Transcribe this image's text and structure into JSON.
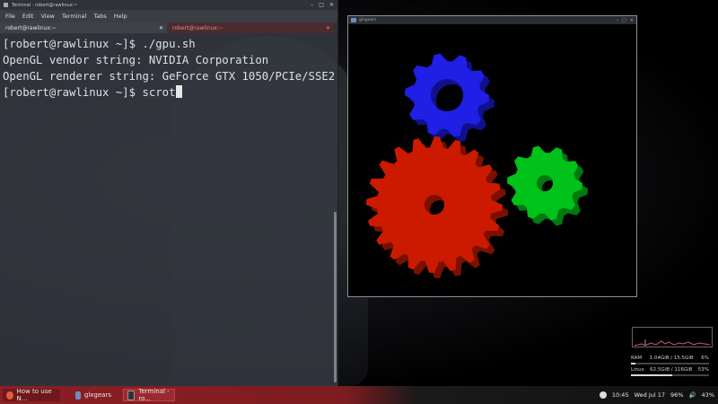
{
  "terminal": {
    "window_title": "Terminal - robert@rawlinux:~",
    "menu": [
      "File",
      "Edit",
      "View",
      "Terminal",
      "Tabs",
      "Help"
    ],
    "tabs": [
      {
        "label": "robert@rawlinux:~",
        "active": true
      },
      {
        "label": "robert@rawlinux:~",
        "active": false
      }
    ],
    "lines": [
      "[robert@rawlinux ~]$ ./gpu.sh",
      "OpenGL vendor string: NVIDIA Corporation",
      "OpenGL renderer string: GeForce GTX 1050/PCIe/SSE2",
      "[robert@rawlinux ~]$ scrot"
    ]
  },
  "glxgears": {
    "window_title": "glxgears",
    "colors": {
      "red": "#cc1a00",
      "green": "#00c21a",
      "blue": "#1f1fe6"
    }
  },
  "conky": {
    "stats": [
      {
        "label": "RAM",
        "value": "1.04GiB / 15.5GiB",
        "percent": "6%",
        "fraction": 0.06
      },
      {
        "label": "Linux",
        "value": "62.5GiB / 116GiB",
        "percent": "53%",
        "fraction": 0.53
      }
    ]
  },
  "taskbar": {
    "tasks": [
      {
        "label": "How to use N...",
        "icon": "browser-icon"
      },
      {
        "label": "glxgears",
        "icon": "window-icon"
      },
      {
        "label": "Terminal - ro...",
        "icon": "terminal-icon"
      }
    ],
    "clock": "10:45",
    "date": "Wed Jul 17",
    "battery": "96%",
    "volume": "43%"
  },
  "theme": {
    "accent": "#8b1f24",
    "terminal_bg": "#343840",
    "tab_inactive_text": "#e08a8a"
  }
}
